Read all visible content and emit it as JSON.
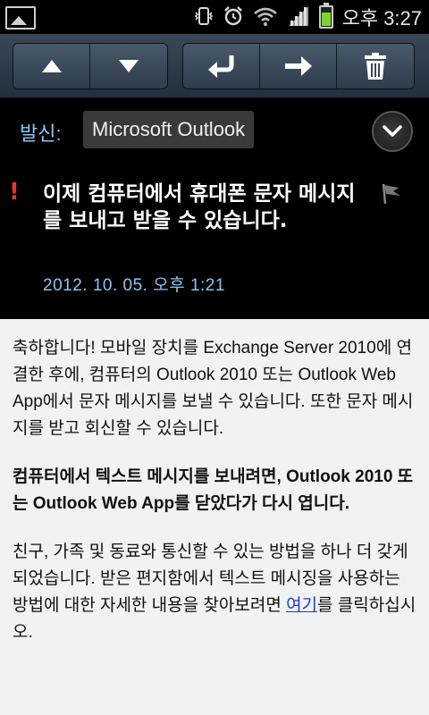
{
  "status_bar": {
    "time": "오후 3:27",
    "icons": [
      "gallery-icon",
      "vibrate-icon",
      "alarm-icon",
      "wifi-icon",
      "signal-icon",
      "battery-icon"
    ]
  },
  "toolbar": {
    "buttons": [
      "previous-arrow-up",
      "next-arrow-down",
      "reply",
      "forward",
      "delete"
    ]
  },
  "message": {
    "sender_label": "발신:",
    "sender": "Microsoft Outlook",
    "priority_mark": "!",
    "subject": "이제 컴퓨터에서 휴대폰 문자 메시지를 보내고 받을 수 있습니다.",
    "date": "2012. 10. 05.  오후 1:21",
    "body": {
      "p1": "축하합니다! 모바일 장치를 Exchange Server 2010에 연결한 후에, 컴퓨터의 Outlook 2010 또는 Outlook Web App에서 문자 메시지를 보낼 수 있습니다. 또한 문자 메시지를 받고 회신할 수 있습니다.",
      "p2": "컴퓨터에서 텍스트 메시지를 보내려면, Outlook 2010 또는 Outlook Web App를 닫았다가 다시 엽니다.",
      "p3_before_link": "친구, 가족 및 동료와 통신할 수 있는 방법을 하나 더 갖게 되었습니다. 받은 편지함에서 텍스트 메시징을 사용하는 방법에 대한 자세한 내용을 찾아보려면 ",
      "p3_link": "여기",
      "p3_after_link": "를 클릭하십시오."
    }
  },
  "colors": {
    "accent_blue": "#8cc4f0",
    "priority_red": "#e23b2f",
    "link_blue": "#1a3bd4",
    "body_bg": "#f2f2f2"
  }
}
